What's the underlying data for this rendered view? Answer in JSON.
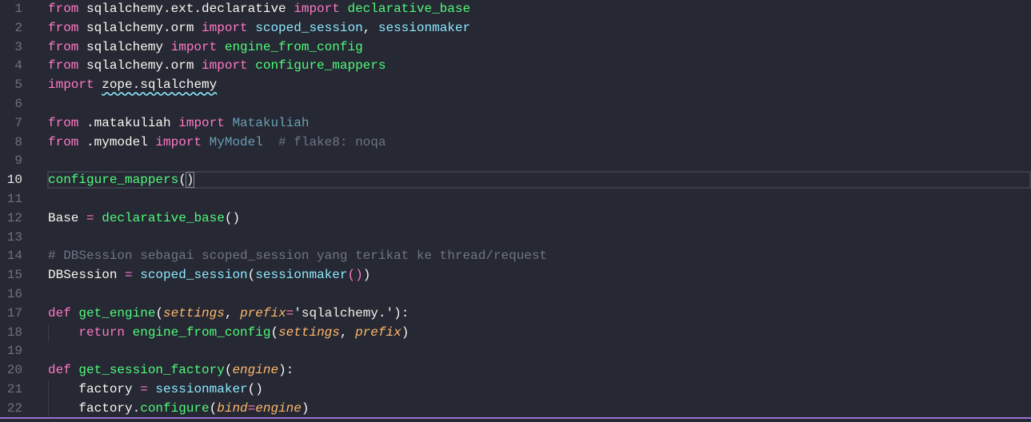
{
  "editor": {
    "active_line": 10,
    "lines": [
      [
        [
          "kw",
          "from"
        ],
        [
          "tx",
          " sqlalchemy.ext.declarative "
        ],
        [
          "kw",
          "import"
        ],
        [
          "fn",
          " declarative_base"
        ]
      ],
      [
        [
          "kw",
          "from"
        ],
        [
          "tx",
          " sqlalchemy.orm "
        ],
        [
          "kw",
          "import"
        ],
        [
          "cy",
          " scoped_session"
        ],
        [
          "tx",
          ", "
        ],
        [
          "cy",
          "sessionmaker"
        ]
      ],
      [
        [
          "kw",
          "from"
        ],
        [
          "tx",
          " sqlalchemy "
        ],
        [
          "kw",
          "import"
        ],
        [
          "fn",
          " engine_from_config"
        ]
      ],
      [
        [
          "kw",
          "from"
        ],
        [
          "tx",
          " sqlalchemy.orm "
        ],
        [
          "kw",
          "import"
        ],
        [
          "fn",
          " configure_mappers"
        ]
      ],
      [
        [
          "kw",
          "import"
        ],
        [
          "tx",
          " "
        ],
        [
          "wavy",
          "zope.sqlalchemy"
        ]
      ],
      [],
      [
        [
          "kw",
          "from"
        ],
        [
          "tx",
          " .matakuliah "
        ],
        [
          "kw",
          "import"
        ],
        [
          "cls",
          " Matakuliah"
        ]
      ],
      [
        [
          "kw",
          "from"
        ],
        [
          "tx",
          " .mymodel "
        ],
        [
          "kw",
          "import"
        ],
        [
          "cls",
          " MyModel"
        ],
        [
          "cm",
          "  # flake8: noqa"
        ]
      ],
      [],
      [
        [
          "fn",
          "configure_mappers"
        ],
        [
          "tx",
          "("
        ],
        [
          "brk",
          ")"
        ]
      ],
      [],
      [
        [
          "tx",
          "Base "
        ],
        [
          "op",
          "="
        ],
        [
          "fn",
          " declarative_base"
        ],
        [
          "tx",
          "()"
        ]
      ],
      [],
      [
        [
          "cm",
          "# DBSession sebagai scoped_session yang terikat ke thread/request"
        ]
      ],
      [
        [
          "tx",
          "DBSession "
        ],
        [
          "op",
          "="
        ],
        [
          "cy",
          " scoped_session"
        ],
        [
          "tx",
          "("
        ],
        [
          "cy",
          "sessionmaker"
        ],
        [
          "op",
          "()"
        ],
        [
          "tx",
          ")"
        ]
      ],
      [],
      [
        [
          "kw",
          "def"
        ],
        [
          "fn",
          " get_engine"
        ],
        [
          "tx",
          "("
        ],
        [
          "pa",
          "settings"
        ],
        [
          "tx",
          ", "
        ],
        [
          "pa",
          "prefix"
        ],
        [
          "op",
          "="
        ],
        [
          "st",
          "'sqlalchemy.'"
        ],
        [
          "tx",
          "):"
        ]
      ],
      [
        [
          "tx",
          "    "
        ],
        [
          "kw",
          "return"
        ],
        [
          "fn",
          " engine_from_config"
        ],
        [
          "tx",
          "("
        ],
        [
          "pa",
          "settings"
        ],
        [
          "tx",
          ", "
        ],
        [
          "pa",
          "prefix"
        ],
        [
          "tx",
          ")"
        ]
      ],
      [],
      [
        [
          "kw",
          "def"
        ],
        [
          "fn",
          " get_session_factory"
        ],
        [
          "tx",
          "("
        ],
        [
          "pa",
          "engine"
        ],
        [
          "tx",
          "):"
        ]
      ],
      [
        [
          "tx",
          "    factory "
        ],
        [
          "op",
          "="
        ],
        [
          "cy",
          " sessionmaker"
        ],
        [
          "tx",
          "()"
        ]
      ],
      [
        [
          "tx",
          "    factory."
        ],
        [
          "fn",
          "configure"
        ],
        [
          "tx",
          "("
        ],
        [
          "pa",
          "bind"
        ],
        [
          "op",
          "="
        ],
        [
          "pa",
          "engine"
        ],
        [
          "tx",
          ")"
        ]
      ]
    ]
  }
}
